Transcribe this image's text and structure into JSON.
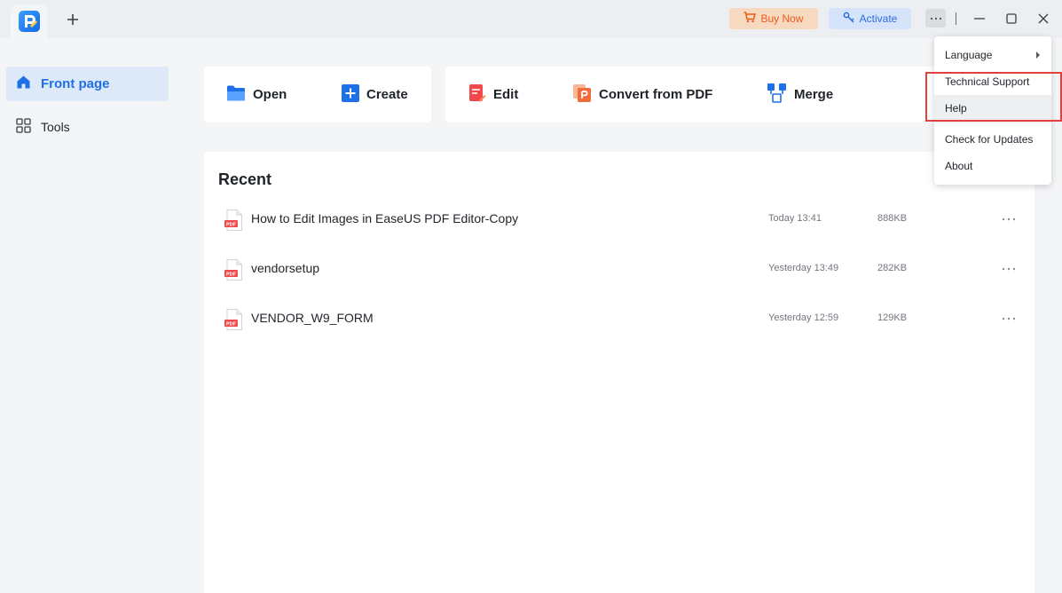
{
  "titlebar": {
    "buy_now": "Buy Now",
    "activate": "Activate"
  },
  "sidebar": {
    "items": [
      {
        "label": "Front page",
        "icon": "home-icon",
        "active": true
      },
      {
        "label": "Tools",
        "icon": "grid-icon",
        "active": false
      }
    ]
  },
  "actions": [
    {
      "label": "Open",
      "icon": "folder-icon"
    },
    {
      "label": "Create",
      "icon": "plus-square-icon"
    },
    {
      "label": "Edit",
      "icon": "edit-doc-icon"
    },
    {
      "label": "Convert from PDF",
      "icon": "convert-icon"
    },
    {
      "label": "Merge",
      "icon": "merge-icon"
    }
  ],
  "recent": {
    "title": "Recent",
    "files": [
      {
        "name": "How to Edit Images in EaseUS PDF Editor-Copy",
        "time": "Today 13:41",
        "size": "888KB",
        "badge": "PDF"
      },
      {
        "name": "vendorsetup",
        "time": "Yesterday 13:49",
        "size": "282KB",
        "badge": "PDF"
      },
      {
        "name": "VENDOR_W9_FORM",
        "time": "Yesterday 12:59",
        "size": "129KB",
        "badge": "PDF"
      }
    ]
  },
  "menu": {
    "items": [
      {
        "label": "Language",
        "has_submenu": true
      },
      {
        "label": "Technical Support"
      },
      {
        "label": "Help"
      },
      {
        "label": "Check for Updates"
      },
      {
        "label": "About"
      }
    ]
  },
  "colors": {
    "accent": "#1f6fe8",
    "buy_now_text": "#ec5a1a",
    "highlight": "#e23f3f"
  }
}
